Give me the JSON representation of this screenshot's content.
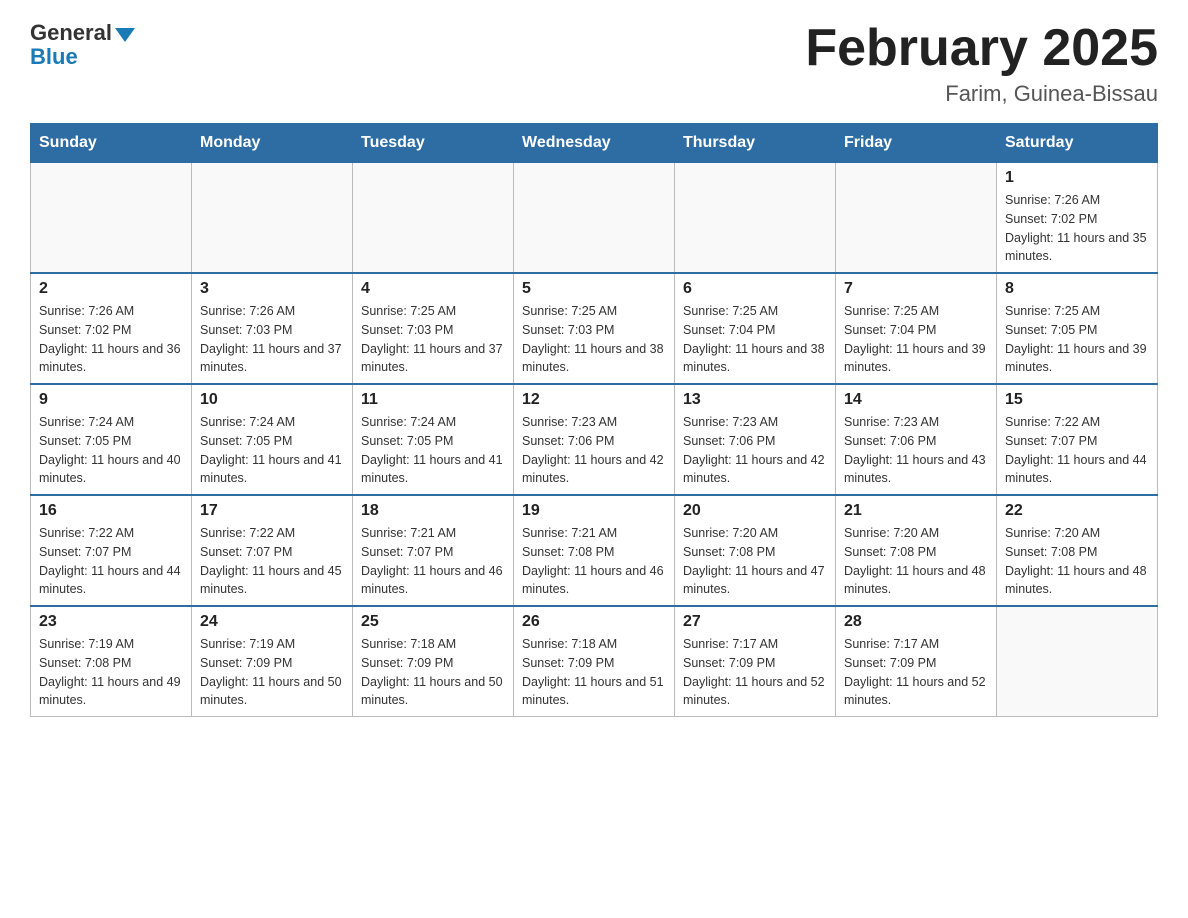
{
  "header": {
    "logo_general": "General",
    "logo_blue": "Blue",
    "month_title": "February 2025",
    "location": "Farim, Guinea-Bissau"
  },
  "weekdays": [
    "Sunday",
    "Monday",
    "Tuesday",
    "Wednesday",
    "Thursday",
    "Friday",
    "Saturday"
  ],
  "weeks": [
    [
      {
        "day": "",
        "info": ""
      },
      {
        "day": "",
        "info": ""
      },
      {
        "day": "",
        "info": ""
      },
      {
        "day": "",
        "info": ""
      },
      {
        "day": "",
        "info": ""
      },
      {
        "day": "",
        "info": ""
      },
      {
        "day": "1",
        "info": "Sunrise: 7:26 AM\nSunset: 7:02 PM\nDaylight: 11 hours and 35 minutes."
      }
    ],
    [
      {
        "day": "2",
        "info": "Sunrise: 7:26 AM\nSunset: 7:02 PM\nDaylight: 11 hours and 36 minutes."
      },
      {
        "day": "3",
        "info": "Sunrise: 7:26 AM\nSunset: 7:03 PM\nDaylight: 11 hours and 37 minutes."
      },
      {
        "day": "4",
        "info": "Sunrise: 7:25 AM\nSunset: 7:03 PM\nDaylight: 11 hours and 37 minutes."
      },
      {
        "day": "5",
        "info": "Sunrise: 7:25 AM\nSunset: 7:03 PM\nDaylight: 11 hours and 38 minutes."
      },
      {
        "day": "6",
        "info": "Sunrise: 7:25 AM\nSunset: 7:04 PM\nDaylight: 11 hours and 38 minutes."
      },
      {
        "day": "7",
        "info": "Sunrise: 7:25 AM\nSunset: 7:04 PM\nDaylight: 11 hours and 39 minutes."
      },
      {
        "day": "8",
        "info": "Sunrise: 7:25 AM\nSunset: 7:05 PM\nDaylight: 11 hours and 39 minutes."
      }
    ],
    [
      {
        "day": "9",
        "info": "Sunrise: 7:24 AM\nSunset: 7:05 PM\nDaylight: 11 hours and 40 minutes."
      },
      {
        "day": "10",
        "info": "Sunrise: 7:24 AM\nSunset: 7:05 PM\nDaylight: 11 hours and 41 minutes."
      },
      {
        "day": "11",
        "info": "Sunrise: 7:24 AM\nSunset: 7:05 PM\nDaylight: 11 hours and 41 minutes."
      },
      {
        "day": "12",
        "info": "Sunrise: 7:23 AM\nSunset: 7:06 PM\nDaylight: 11 hours and 42 minutes."
      },
      {
        "day": "13",
        "info": "Sunrise: 7:23 AM\nSunset: 7:06 PM\nDaylight: 11 hours and 42 minutes."
      },
      {
        "day": "14",
        "info": "Sunrise: 7:23 AM\nSunset: 7:06 PM\nDaylight: 11 hours and 43 minutes."
      },
      {
        "day": "15",
        "info": "Sunrise: 7:22 AM\nSunset: 7:07 PM\nDaylight: 11 hours and 44 minutes."
      }
    ],
    [
      {
        "day": "16",
        "info": "Sunrise: 7:22 AM\nSunset: 7:07 PM\nDaylight: 11 hours and 44 minutes."
      },
      {
        "day": "17",
        "info": "Sunrise: 7:22 AM\nSunset: 7:07 PM\nDaylight: 11 hours and 45 minutes."
      },
      {
        "day": "18",
        "info": "Sunrise: 7:21 AM\nSunset: 7:07 PM\nDaylight: 11 hours and 46 minutes."
      },
      {
        "day": "19",
        "info": "Sunrise: 7:21 AM\nSunset: 7:08 PM\nDaylight: 11 hours and 46 minutes."
      },
      {
        "day": "20",
        "info": "Sunrise: 7:20 AM\nSunset: 7:08 PM\nDaylight: 11 hours and 47 minutes."
      },
      {
        "day": "21",
        "info": "Sunrise: 7:20 AM\nSunset: 7:08 PM\nDaylight: 11 hours and 48 minutes."
      },
      {
        "day": "22",
        "info": "Sunrise: 7:20 AM\nSunset: 7:08 PM\nDaylight: 11 hours and 48 minutes."
      }
    ],
    [
      {
        "day": "23",
        "info": "Sunrise: 7:19 AM\nSunset: 7:08 PM\nDaylight: 11 hours and 49 minutes."
      },
      {
        "day": "24",
        "info": "Sunrise: 7:19 AM\nSunset: 7:09 PM\nDaylight: 11 hours and 50 minutes."
      },
      {
        "day": "25",
        "info": "Sunrise: 7:18 AM\nSunset: 7:09 PM\nDaylight: 11 hours and 50 minutes."
      },
      {
        "day": "26",
        "info": "Sunrise: 7:18 AM\nSunset: 7:09 PM\nDaylight: 11 hours and 51 minutes."
      },
      {
        "day": "27",
        "info": "Sunrise: 7:17 AM\nSunset: 7:09 PM\nDaylight: 11 hours and 52 minutes."
      },
      {
        "day": "28",
        "info": "Sunrise: 7:17 AM\nSunset: 7:09 PM\nDaylight: 11 hours and 52 minutes."
      },
      {
        "day": "",
        "info": ""
      }
    ]
  ]
}
